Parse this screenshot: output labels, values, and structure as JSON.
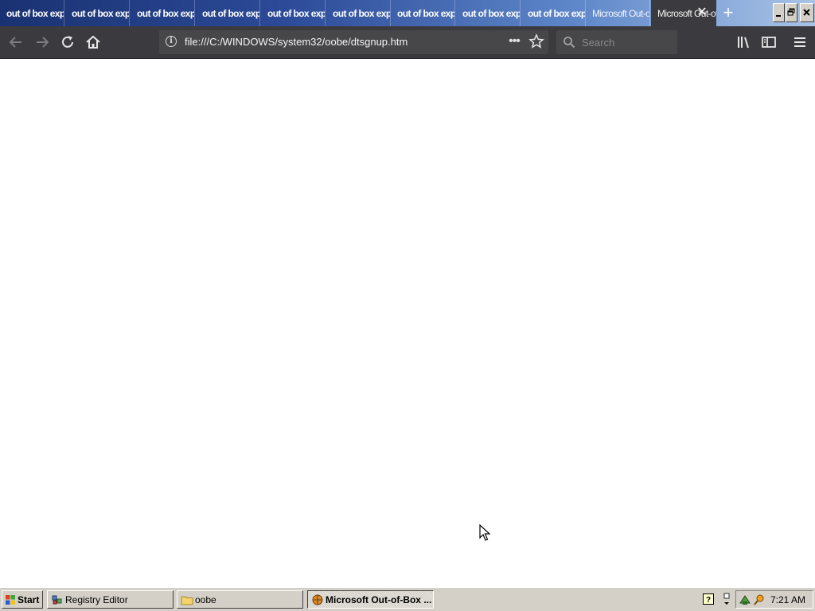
{
  "browser": {
    "tabs": [
      {
        "title": "out of box experience",
        "active": false
      },
      {
        "title": "out of box experience",
        "active": false
      },
      {
        "title": "out of box experience",
        "active": false
      },
      {
        "title": "out of box experience",
        "active": false
      },
      {
        "title": "out of box experience",
        "active": false
      },
      {
        "title": "out of box experience",
        "active": false
      },
      {
        "title": "out of box experience",
        "active": false
      },
      {
        "title": "out of box experience",
        "active": false
      },
      {
        "title": "out of box experience",
        "active": false
      },
      {
        "title": "Microsoft Out-of-Box Experience",
        "active": false
      },
      {
        "title": "Microsoft Out-of-Box Experience",
        "active": true
      }
    ],
    "url": "file:///C:/WINDOWS/system32/oobe/dtsgnup.htm",
    "search_placeholder": "Search",
    "more_glyph": "•••"
  },
  "taskbar": {
    "start_label": "Start",
    "tasks": [
      {
        "label": "Registry Editor",
        "pressed": false
      },
      {
        "label": "oobe",
        "pressed": false
      },
      {
        "label": "Microsoft Out-of-Box ...",
        "pressed": true
      }
    ],
    "clock": "7:21 AM"
  },
  "colors": {
    "toolbar": "#3b3b3f",
    "tab_gradient_start": "#1a3272",
    "tab_gradient_end": "#a9c3e6",
    "taskbar": "#d4d0c8"
  }
}
